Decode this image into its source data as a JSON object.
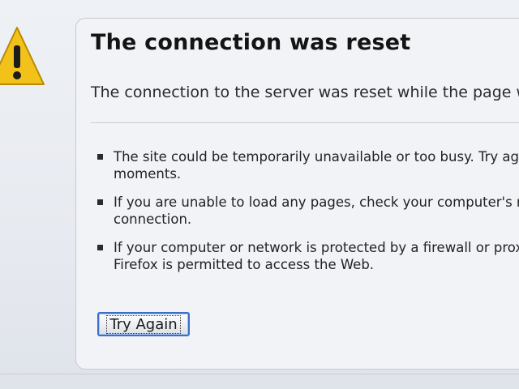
{
  "error": {
    "title": "The connection was reset",
    "description": "The connection to the server was reset while the page w",
    "bullets": [
      {
        "line1": "The site could be temporarily unavailable or too busy. Try ag",
        "line2": "moments."
      },
      {
        "line1": "If you are unable to load any pages, check your computer's n",
        "line2": "connection."
      },
      {
        "line1": "If your computer or network is protected by a firewall or prox",
        "line2": "Firefox is permitted to access the Web."
      }
    ],
    "button_label": "Try Again"
  },
  "colors": {
    "warning_fill": "#f2c21b",
    "warning_stroke": "#b88a00",
    "button_border": "#3b6fc9"
  },
  "icons": {
    "warning": "warning-icon"
  }
}
